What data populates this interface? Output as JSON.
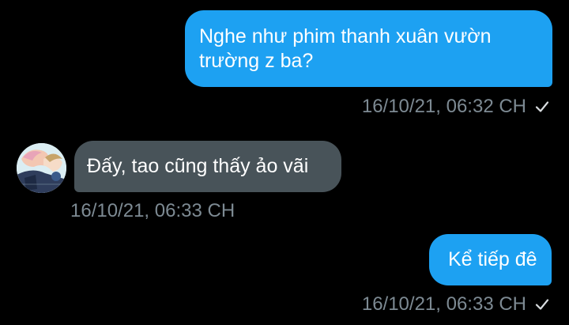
{
  "colors": {
    "background": "#000000",
    "outgoing_bubble": "#1da1f2",
    "incoming_bubble": "#485359",
    "timestamp": "#7d8a93",
    "read_check": "#d9dde0"
  },
  "messages": [
    {
      "direction": "outgoing",
      "text": "Nghe như phim thanh xuân vườn trường z ba?",
      "timestamp": "16/10/21, 06:32 CH",
      "status_icon": "check-icon"
    },
    {
      "direction": "incoming",
      "text": "Đấy, tao cũng thấy ảo vãi",
      "timestamp": "16/10/21, 06:33 CH",
      "avatar_icon": "avatar-anime-illustration"
    },
    {
      "direction": "outgoing",
      "text": "Kể tiếp đê",
      "timestamp": "16/10/21, 06:33 CH",
      "status_icon": "check-icon"
    }
  ]
}
